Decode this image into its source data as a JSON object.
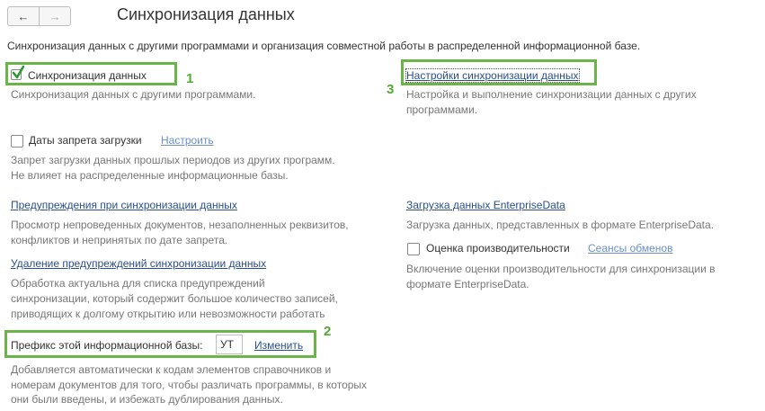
{
  "nav": {
    "back_icon": "arrow-left-icon",
    "forward_icon": "arrow-right-icon"
  },
  "title": "Синхронизация данных",
  "description": "Синхронизация данных с другими программами и организация совместной работы в распределенной информационной базе.",
  "sync": {
    "checkbox_label": "Синхронизация данных",
    "checked": true,
    "hint": "Синхронизация данных с другими программами.",
    "badge": "1"
  },
  "sync_settings": {
    "link": "Настройки синхронизации данных",
    "hint_line1": "Настройка и выполнение синхронизации данных с других",
    "hint_line2": "программами.",
    "badge": "3"
  },
  "load_ban": {
    "checkbox_label": "Даты запрета загрузки",
    "checked": false,
    "config_link": "Настроить",
    "hint_line1": "Запрет загрузки данных прошлых периодов из других программ.",
    "hint_line2": "Не влияет на распределенные информационные базы."
  },
  "warnings": {
    "link": "Предупреждения при синхронизации данных",
    "hint_line1": "Просмотр непроведенных документов, незаполненных реквизитов,",
    "hint_line2": "конфликтов и непринятых по дате запрета."
  },
  "enterprise_data": {
    "link": "Загрузка данных EnterpriseData",
    "hint": "Загрузка данных, представленных в формате EnterpriseData."
  },
  "performance": {
    "checkbox_label": "Оценка производительности",
    "checked": false,
    "link": "Сеансы обменов",
    "hint_line1": "Включение оценки производительности для синхронизации в",
    "hint_line2": "формате EnterpriseData."
  },
  "delete_warnings": {
    "link": "Удаление предупреждений синхронизации данных",
    "hint_line1": "Обработка актуальна для списка предупреждений",
    "hint_line2": "синхронизации, который содержит большое количество записей,",
    "hint_line3": "приводящих к долгому открытию или невозможности работать"
  },
  "prefix": {
    "label": "Префикс этой информационной базы:",
    "value": "УТ",
    "change_link": "Изменить",
    "badge": "2",
    "hint_line1": "Добавляется автоматически к кодам элементов справочников и",
    "hint_line2": "номерам документов для того, чтобы различать программы, в которых",
    "hint_line3": "они были введены, и избежать дублирования данных."
  },
  "colors": {
    "highlight": "#6ab44a",
    "link": "#2a4e8c"
  }
}
